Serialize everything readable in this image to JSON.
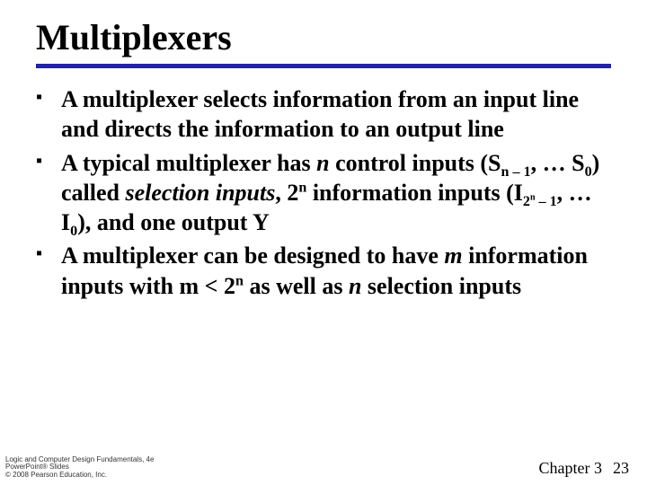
{
  "title": "Multiplexers",
  "bullets": {
    "b1": "A multiplexer selects information from an input line and directs the information to an output line",
    "b2": {
      "p1": "A typical multiplexer has ",
      "n": "n",
      "p2": " control inputs (S",
      "sub1": "n – 1",
      "p3": ", … S",
      "sub2": "0",
      "p4": ") called ",
      "sel": "selection inputs",
      "p5": ", 2",
      "sup1": "n",
      "p6": " information inputs (I",
      "sub3_a": "2",
      "sub3_b": "n",
      "sub3_c": " – 1",
      "p7": ", … I",
      "sub4": "0",
      "p8": "), and one output Y"
    },
    "b3": {
      "p1": "A multiplexer can be designed to have ",
      "m1": "m",
      "p2": " information inputs with m < 2",
      "sup1": "n",
      "p3": " as well as ",
      "n1": "n",
      "p4": " selection inputs"
    }
  },
  "footer": {
    "line1": "Logic and Computer Design Fundamentals, 4e",
    "line2": "PowerPoint® Slides",
    "line3": "© 2008 Pearson Education, Inc.",
    "chapter": "Chapter 3",
    "page": "23"
  }
}
